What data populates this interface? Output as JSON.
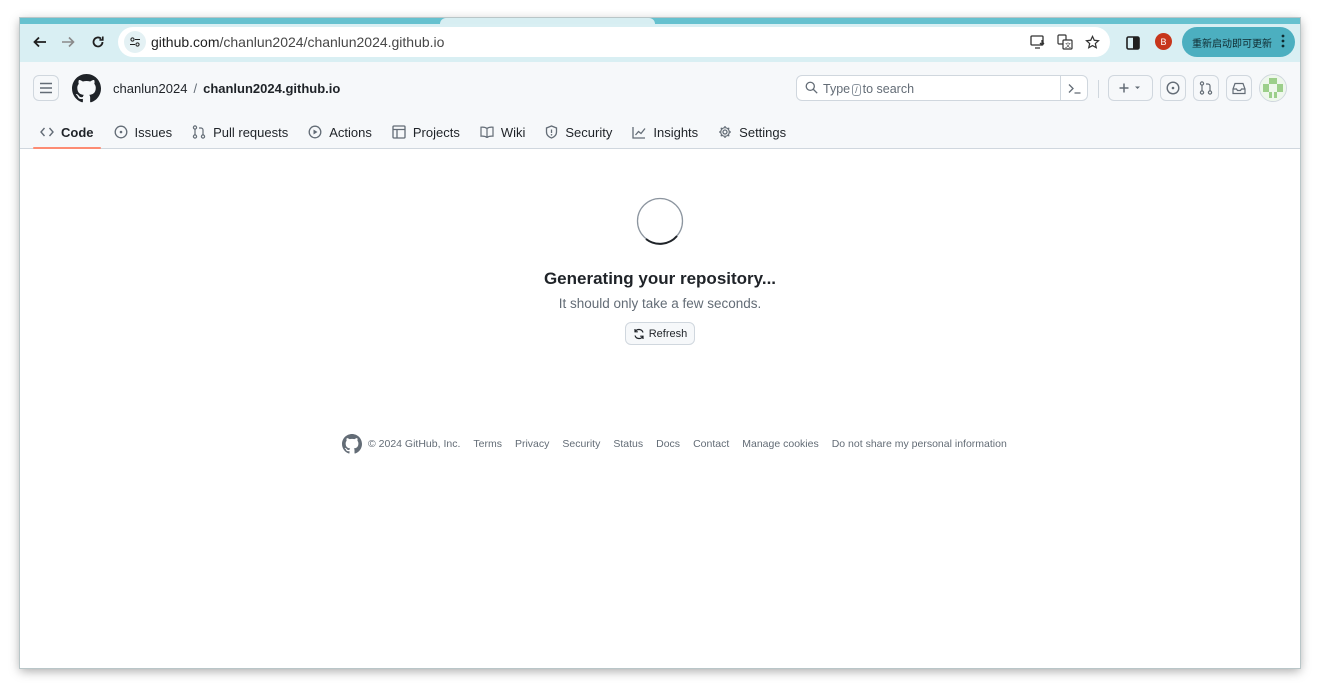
{
  "browser": {
    "url_host": "github.com",
    "url_path": "/chanlun2024/chanlun2024.github.io",
    "profile_initial": "B",
    "update_label": "重新启动即可更新"
  },
  "header": {
    "owner": "chanlun2024",
    "separator": "/",
    "repo": "chanlun2024.github.io",
    "search_prefix": "Type",
    "search_key": "/",
    "search_suffix": "to search"
  },
  "tabs": [
    {
      "label": "Code",
      "icon": "code-icon"
    },
    {
      "label": "Issues",
      "icon": "issue-icon"
    },
    {
      "label": "Pull requests",
      "icon": "pull-request-icon"
    },
    {
      "label": "Actions",
      "icon": "play-icon"
    },
    {
      "label": "Projects",
      "icon": "table-icon"
    },
    {
      "label": "Wiki",
      "icon": "book-icon"
    },
    {
      "label": "Security",
      "icon": "shield-icon"
    },
    {
      "label": "Insights",
      "icon": "graph-icon"
    },
    {
      "label": "Settings",
      "icon": "gear-icon"
    }
  ],
  "main": {
    "title": "Generating your repository...",
    "subtitle": "It should only take a few seconds.",
    "refresh_label": "Refresh"
  },
  "footer": {
    "copyright": "© 2024 GitHub, Inc.",
    "links": [
      "Terms",
      "Privacy",
      "Security",
      "Status",
      "Docs",
      "Contact",
      "Manage cookies",
      "Do not share my personal information"
    ]
  },
  "colors": {
    "browser_frame": "#66c1cf",
    "toolbar": "#d9eff3",
    "update_button": "#4cafc0",
    "active_tab_underline": "#fd8c73",
    "profile_badge": "#c7361c"
  }
}
